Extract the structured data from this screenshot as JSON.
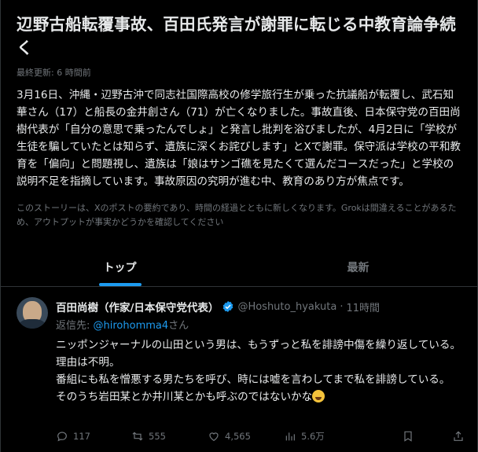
{
  "story": {
    "headline": "辺野古船転覆事故、百田氏発言が謝罪に転じる中教育論争続く",
    "updated": "最終更新: 6 時間前",
    "summary": "3月16日、沖縄・辺野古沖で同志社国際高校の修学旅行生が乗った抗議船が転覆し、武石知華さん（17）と船長の金井創さん（71）が亡くなりました。事故直後、日本保守党の百田尚樹代表が「自分の意思で乗ったんでしょ」と発言し批判を浴びましたが、4月2日に「学校が生徒を騙していたとは知らず、遺族に深くお詫びします」とXで謝罪。保守派は学校の平和教育を「偏向」と問題視し、遺族は「娘はサンゴ礁を見たくて選んだコースだった」と学校の説明不足を指摘しています。事故原因の究明が進む中、教育のあり方が焦点です。",
    "disclaimer": "このストーリーは、Xのポストの要約であり、時間の経過とともに新しくなります。Grokは間違えることがあるため、アウトプットが事実かどうかを確認してください"
  },
  "tabs": [
    {
      "label": "トップ",
      "active": true
    },
    {
      "label": "最新",
      "active": false
    }
  ],
  "post": {
    "display_name": "百田尚樹（作家/日本保守党代表）",
    "handle": "@Hoshuto_hyakuta",
    "separator": "·",
    "time": "11時間",
    "reply_prefix": "返信先: ",
    "reply_mention": "@hirohomma4",
    "reply_suffix": "さん",
    "lines": [
      "ニッポンジャーナルの山田という男は、もうずっと私を誹謗中傷を繰り返している。理由は不明。",
      "番組にも私を憎悪する男たちを呼び、時には嘘を言わしてまで私を誹謗している。",
      "そのうち岩田某とか井川某とかも呼ぶのではないかな"
    ],
    "emoji": "sweat-smile-emoji",
    "replies": "117",
    "reposts": "555",
    "likes": "4,565",
    "views": "5.6万",
    "accent_color": "#1d9bf0",
    "verified_color": "#1d9bf0"
  }
}
